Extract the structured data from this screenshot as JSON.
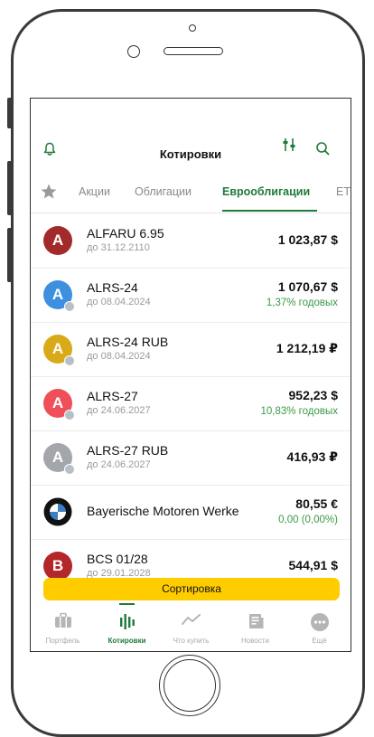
{
  "header": {
    "title": "Котировки"
  },
  "tabs": [
    {
      "label": "Акции"
    },
    {
      "label": "Облигации"
    },
    {
      "label": "Еврооблигации"
    },
    {
      "label": "ЕТ"
    }
  ],
  "quotes": [
    {
      "avatar": "A",
      "avatar_color": "#a32a2a",
      "name": "ALFARU 6.95",
      "date": "до 31.12.2110",
      "price": "1 023,87 $",
      "yield": ""
    },
    {
      "avatar": "A",
      "avatar_color": "#3d8fe0",
      "name": "ALRS-24",
      "date": "до 08.04.2024",
      "price": "1 070,67 $",
      "yield": "1,37% годовых"
    },
    {
      "avatar": "A",
      "avatar_color": "#d8a918",
      "name": "ALRS-24 RUB",
      "date": "до 08.04.2024",
      "price": "1 212,19 ₽",
      "yield": ""
    },
    {
      "avatar": "A",
      "avatar_color": "#ef4f58",
      "name": "ALRS-27",
      "date": "до 24.06.2027",
      "price": "952,23 $",
      "yield": "10,83% годовых"
    },
    {
      "avatar": "A",
      "avatar_color": "#a3a6ab",
      "name": "ALRS-27 RUB",
      "date": "до 24.06.2027",
      "price": "416,93 ₽",
      "yield": ""
    },
    {
      "avatar": "",
      "avatar_color": "#111111",
      "name": "Bayerische Motoren Werke",
      "date": "",
      "price": "80,55 €",
      "yield": "0,00 (0,00%)"
    },
    {
      "avatar": "B",
      "avatar_color": "#b3262a",
      "name": "BCS 01/28",
      "date": "до 29.01.2028",
      "price": "544,91 $",
      "yield": ""
    }
  ],
  "sort_button": {
    "label": "Сортировка"
  },
  "nav": [
    {
      "label": "Портфель",
      "icon": "briefcase-icon"
    },
    {
      "label": "Котировки",
      "icon": "quotes-icon"
    },
    {
      "label": "Что купить",
      "icon": "trend-icon"
    },
    {
      "label": "Новости",
      "icon": "news-icon"
    },
    {
      "label": "Ещё",
      "icon": "more-icon"
    }
  ],
  "colors": {
    "accent": "#1f7a3a",
    "sort_button": "#ffcc00",
    "yield": "#3a9a45"
  }
}
